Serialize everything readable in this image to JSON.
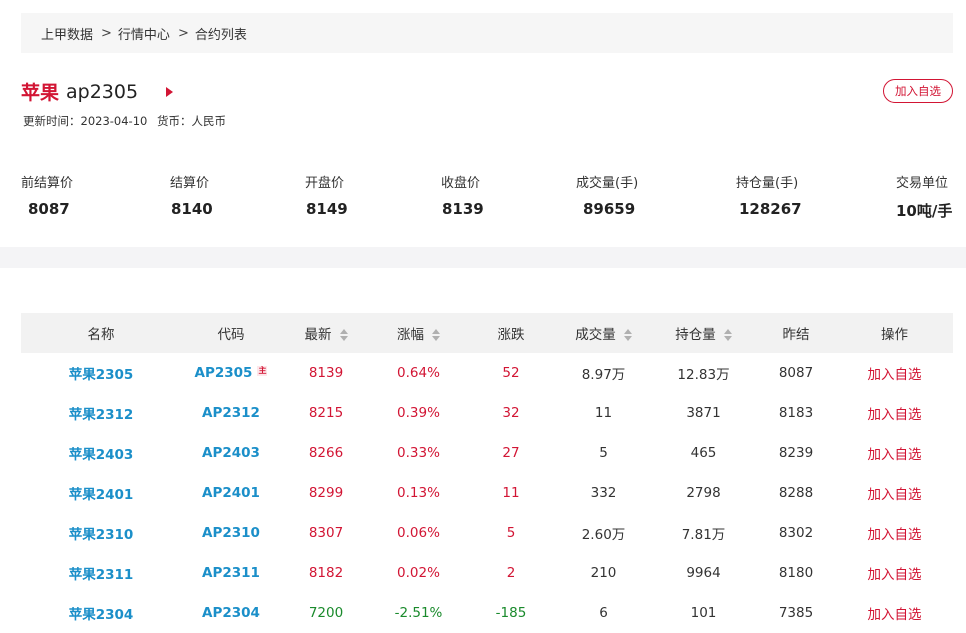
{
  "breadcrumb": {
    "items": [
      "上甲数据",
      "行情中心",
      "合约列表"
    ],
    "separator": ">"
  },
  "header": {
    "name": "苹果",
    "code": "ap2305",
    "update_time": "更新时间：2023-04-10",
    "currency": "货币：人民币",
    "add_fav": "加入自选"
  },
  "stats": [
    {
      "label": "前结算价",
      "value": "8087"
    },
    {
      "label": "结算价",
      "value": "8140"
    },
    {
      "label": "开盘价",
      "value": "8149"
    },
    {
      "label": "收盘价",
      "value": "8139"
    },
    {
      "label": "成交量(手)",
      "value": "89659"
    },
    {
      "label": "持仓量(手)",
      "value": "128267"
    },
    {
      "label": "交易单位",
      "value": "10吨/手"
    }
  ],
  "table": {
    "headers": [
      "名称",
      "代码",
      "最新",
      "涨幅",
      "涨跌",
      "成交量",
      "持仓量",
      "昨结",
      "操作"
    ],
    "main_badge": "主",
    "rows": [
      {
        "name": "苹果2305",
        "code": "AP2305",
        "last": "8139",
        "pct": "0.64%",
        "chg": "52",
        "vol": "8.97万",
        "oi": "12.83万",
        "prev": "8087",
        "op": "加入自选",
        "dir": "up",
        "main": true
      },
      {
        "name": "苹果2312",
        "code": "AP2312",
        "last": "8215",
        "pct": "0.39%",
        "chg": "32",
        "vol": "11",
        "oi": "3871",
        "prev": "8183",
        "op": "加入自选",
        "dir": "up",
        "main": false
      },
      {
        "name": "苹果2403",
        "code": "AP2403",
        "last": "8266",
        "pct": "0.33%",
        "chg": "27",
        "vol": "5",
        "oi": "465",
        "prev": "8239",
        "op": "加入自选",
        "dir": "up",
        "main": false
      },
      {
        "name": "苹果2401",
        "code": "AP2401",
        "last": "8299",
        "pct": "0.13%",
        "chg": "11",
        "vol": "332",
        "oi": "2798",
        "prev": "8288",
        "op": "加入自选",
        "dir": "up",
        "main": false
      },
      {
        "name": "苹果2310",
        "code": "AP2310",
        "last": "8307",
        "pct": "0.06%",
        "chg": "5",
        "vol": "2.60万",
        "oi": "7.81万",
        "prev": "8302",
        "op": "加入自选",
        "dir": "up",
        "main": false
      },
      {
        "name": "苹果2311",
        "code": "AP2311",
        "last": "8182",
        "pct": "0.02%",
        "chg": "2",
        "vol": "210",
        "oi": "9964",
        "prev": "8180",
        "op": "加入自选",
        "dir": "up",
        "main": false
      },
      {
        "name": "苹果2304",
        "code": "AP2304",
        "last": "7200",
        "pct": "-2.51%",
        "chg": "-185",
        "vol": "6",
        "oi": "101",
        "prev": "7385",
        "op": "加入自选",
        "dir": "down",
        "main": false
      }
    ]
  },
  "colors": {
    "up": "#d21534",
    "down": "#1a8a2c",
    "link": "#1b8fc9"
  }
}
